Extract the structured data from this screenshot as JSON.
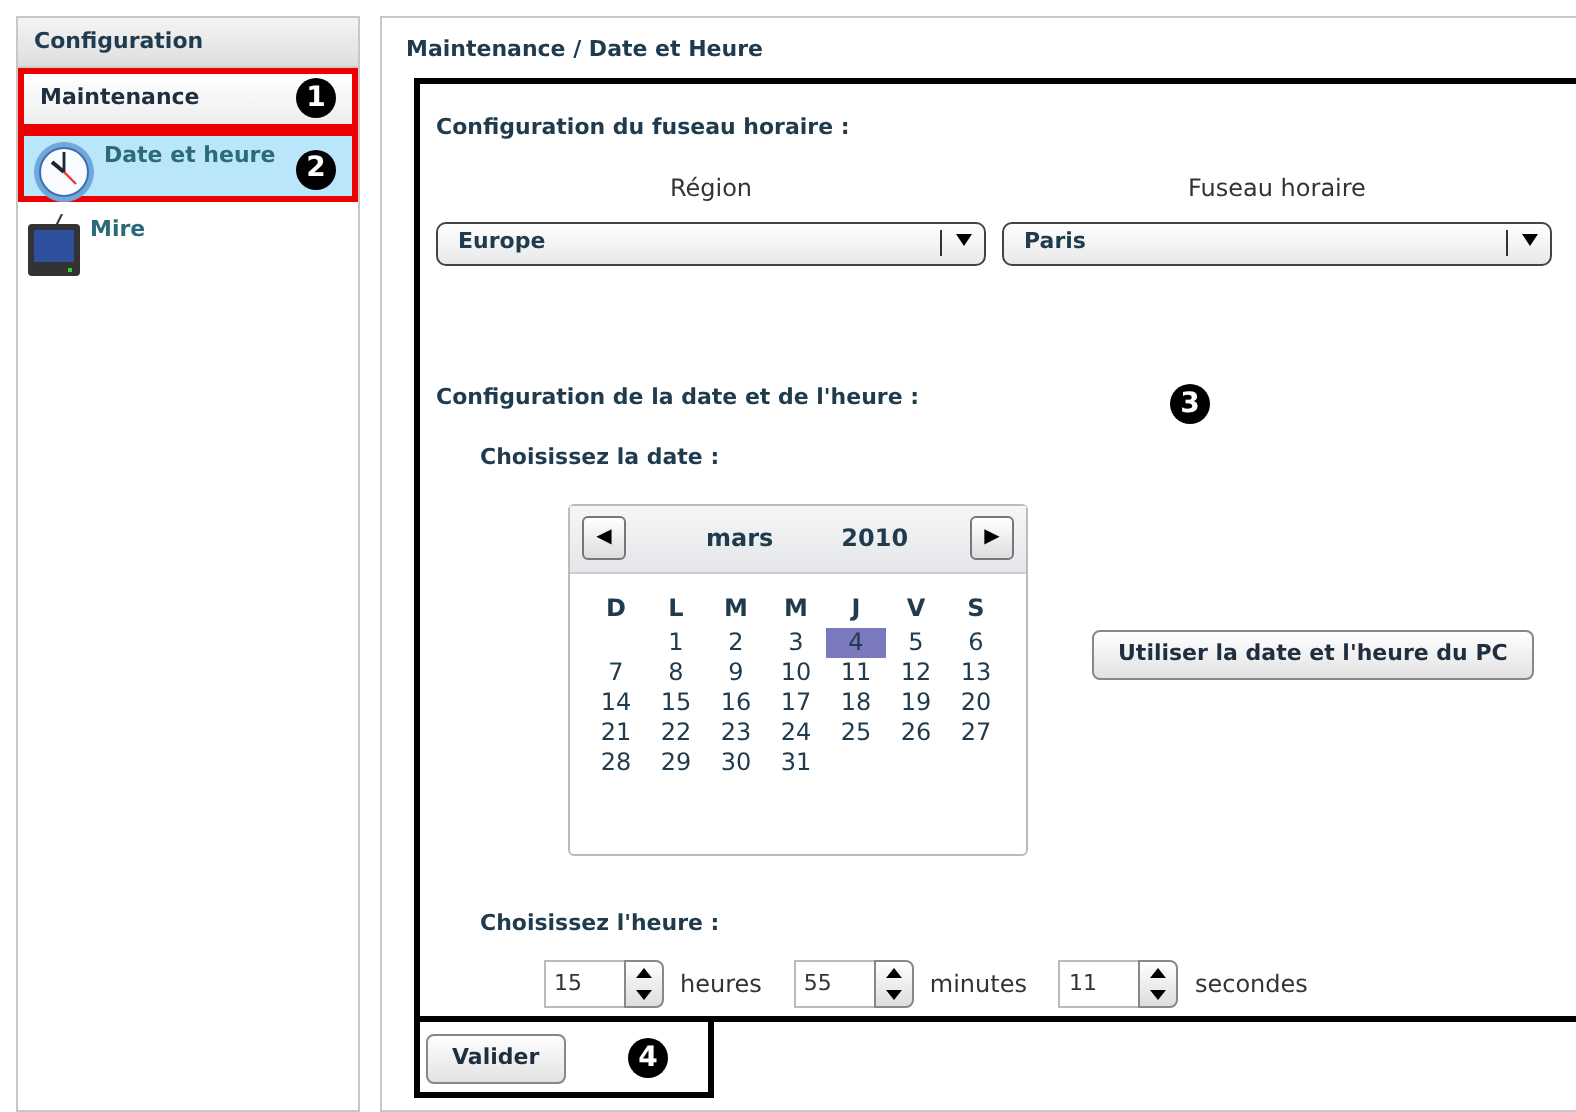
{
  "sidebar": {
    "title": "Configuration",
    "items": [
      {
        "label": "Maintenance",
        "kind": "section",
        "selected": false,
        "annotation": {
          "number": "1",
          "color": "#ee0000"
        }
      },
      {
        "label": "Date et heure",
        "kind": "clock",
        "selected": true,
        "annotation": {
          "number": "2",
          "color": "#ee0000"
        }
      },
      {
        "label": "Mire",
        "kind": "tv",
        "selected": false
      }
    ]
  },
  "breadcrumb": "Maintenance / Date et Heure",
  "main_annotation": {
    "number": "3",
    "color": "#000000"
  },
  "timezone": {
    "heading": "Configuration du fuseau horaire :",
    "fields": [
      {
        "label": "Région",
        "value": "Europe"
      },
      {
        "label": "Fuseau horaire",
        "value": "Paris"
      }
    ]
  },
  "datetime": {
    "heading": "Configuration de la date et de l'heure :",
    "date_label": "Choisissez la date :",
    "calendar": {
      "prev": "◀",
      "month": "mars",
      "year": "2010",
      "next": "▶",
      "weekdays": [
        "D",
        "L",
        "M",
        "M",
        "J",
        "V",
        "S"
      ],
      "weeks": [
        {
          "kind": "start",
          "days": [
            {
              "d": "1",
              "selected": false
            },
            {
              "d": "2",
              "selected": false
            },
            {
              "d": "3",
              "selected": false
            },
            {
              "d": "4",
              "selected": true
            },
            {
              "d": "5",
              "selected": false
            },
            {
              "d": "6",
              "selected": false
            }
          ]
        },
        {
          "kind": "full",
          "days": [
            {
              "d": "7",
              "selected": false
            },
            {
              "d": "8",
              "selected": false
            },
            {
              "d": "9",
              "selected": false
            },
            {
              "d": "10",
              "selected": false
            },
            {
              "d": "11",
              "selected": false
            },
            {
              "d": "12",
              "selected": false
            },
            {
              "d": "13",
              "selected": false
            }
          ]
        },
        {
          "kind": "full",
          "days": [
            {
              "d": "14",
              "selected": false
            },
            {
              "d": "15",
              "selected": false
            },
            {
              "d": "16",
              "selected": false
            },
            {
              "d": "17",
              "selected": false
            },
            {
              "d": "18",
              "selected": false
            },
            {
              "d": "19",
              "selected": false
            },
            {
              "d": "20",
              "selected": false
            }
          ]
        },
        {
          "kind": "full",
          "days": [
            {
              "d": "21",
              "selected": false
            },
            {
              "d": "22",
              "selected": false
            },
            {
              "d": "23",
              "selected": false
            },
            {
              "d": "24",
              "selected": false
            },
            {
              "d": "25",
              "selected": false
            },
            {
              "d": "26",
              "selected": false
            },
            {
              "d": "27",
              "selected": false
            }
          ]
        },
        {
          "kind": "end",
          "days": [
            {
              "d": "28",
              "selected": false
            },
            {
              "d": "29",
              "selected": false
            },
            {
              "d": "30",
              "selected": false
            },
            {
              "d": "31",
              "selected": false
            }
          ]
        }
      ]
    },
    "pc_button": "Utiliser la date et l'heure du PC",
    "time_label": "Choisissez l'heure :",
    "time_fields": [
      {
        "value": "15",
        "unit": "heures"
      },
      {
        "value": "55",
        "unit": "minutes"
      },
      {
        "value": "11",
        "unit": "secondes"
      }
    ]
  },
  "submit": {
    "label": "Valider",
    "annotation": {
      "number": "4",
      "color": "#000000"
    }
  }
}
